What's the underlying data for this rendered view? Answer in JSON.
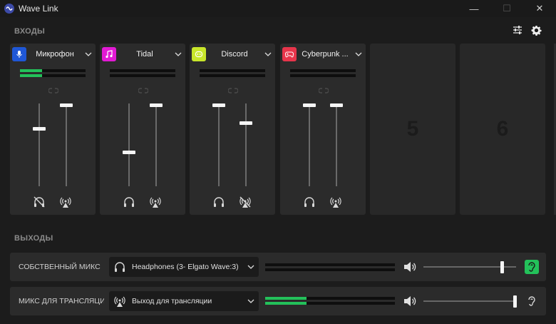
{
  "app": {
    "title": "Wave Link"
  },
  "window_controls": {
    "minimize": "—",
    "maximize": "☐",
    "close": "✕"
  },
  "sections": {
    "inputs": "ВХОДЫ",
    "outputs": "ВЫХОДЫ"
  },
  "toolbar": {
    "mixer_settings_icon": "sliders-icon",
    "settings_icon": "gear-icon"
  },
  "inputs": [
    {
      "name": "Микрофон",
      "icon": "microphone-icon",
      "color": "#1f57d6",
      "meter_level": 0.33,
      "monitor_volume": 0.7,
      "stream_volume": 1.0,
      "monitor_muted": true,
      "stream_muted": false
    },
    {
      "name": "Tidal",
      "icon": "music-note-icon",
      "color": "#e21ad4",
      "meter_level": 0.0,
      "monitor_volume": 0.4,
      "stream_volume": 1.0,
      "monitor_muted": false,
      "stream_muted": false
    },
    {
      "name": "Discord",
      "icon": "discord-icon",
      "color": "#c8e62a",
      "meter_level": 0.0,
      "monitor_volume": 1.0,
      "stream_volume": 0.75,
      "monitor_muted": false,
      "stream_muted": true
    },
    {
      "name": "Cyberpunk ...",
      "icon": "gamepad-icon",
      "color": "#e8354b",
      "meter_level": 0.0,
      "monitor_volume": 1.0,
      "stream_volume": 1.0,
      "monitor_muted": false,
      "stream_muted": false
    }
  ],
  "empty_slots": [
    "5",
    "6"
  ],
  "outputs": [
    {
      "label": "СОБСТВЕННЫЙ МИКС",
      "device": "Headphones (3- Elgato Wave:3)",
      "device_icon": "headphones-icon",
      "meter_level": 0.0,
      "volume": 0.85,
      "monitor_active": true,
      "accent": "#23c15a"
    },
    {
      "label": "МИКС ДЛЯ ТРАНСЛЯЦИИ",
      "device": "Выход для трансляции",
      "device_icon": "broadcast-icon",
      "meter_level": 0.32,
      "volume": 1.0,
      "monitor_active": false,
      "accent": "#23c15a"
    }
  ]
}
